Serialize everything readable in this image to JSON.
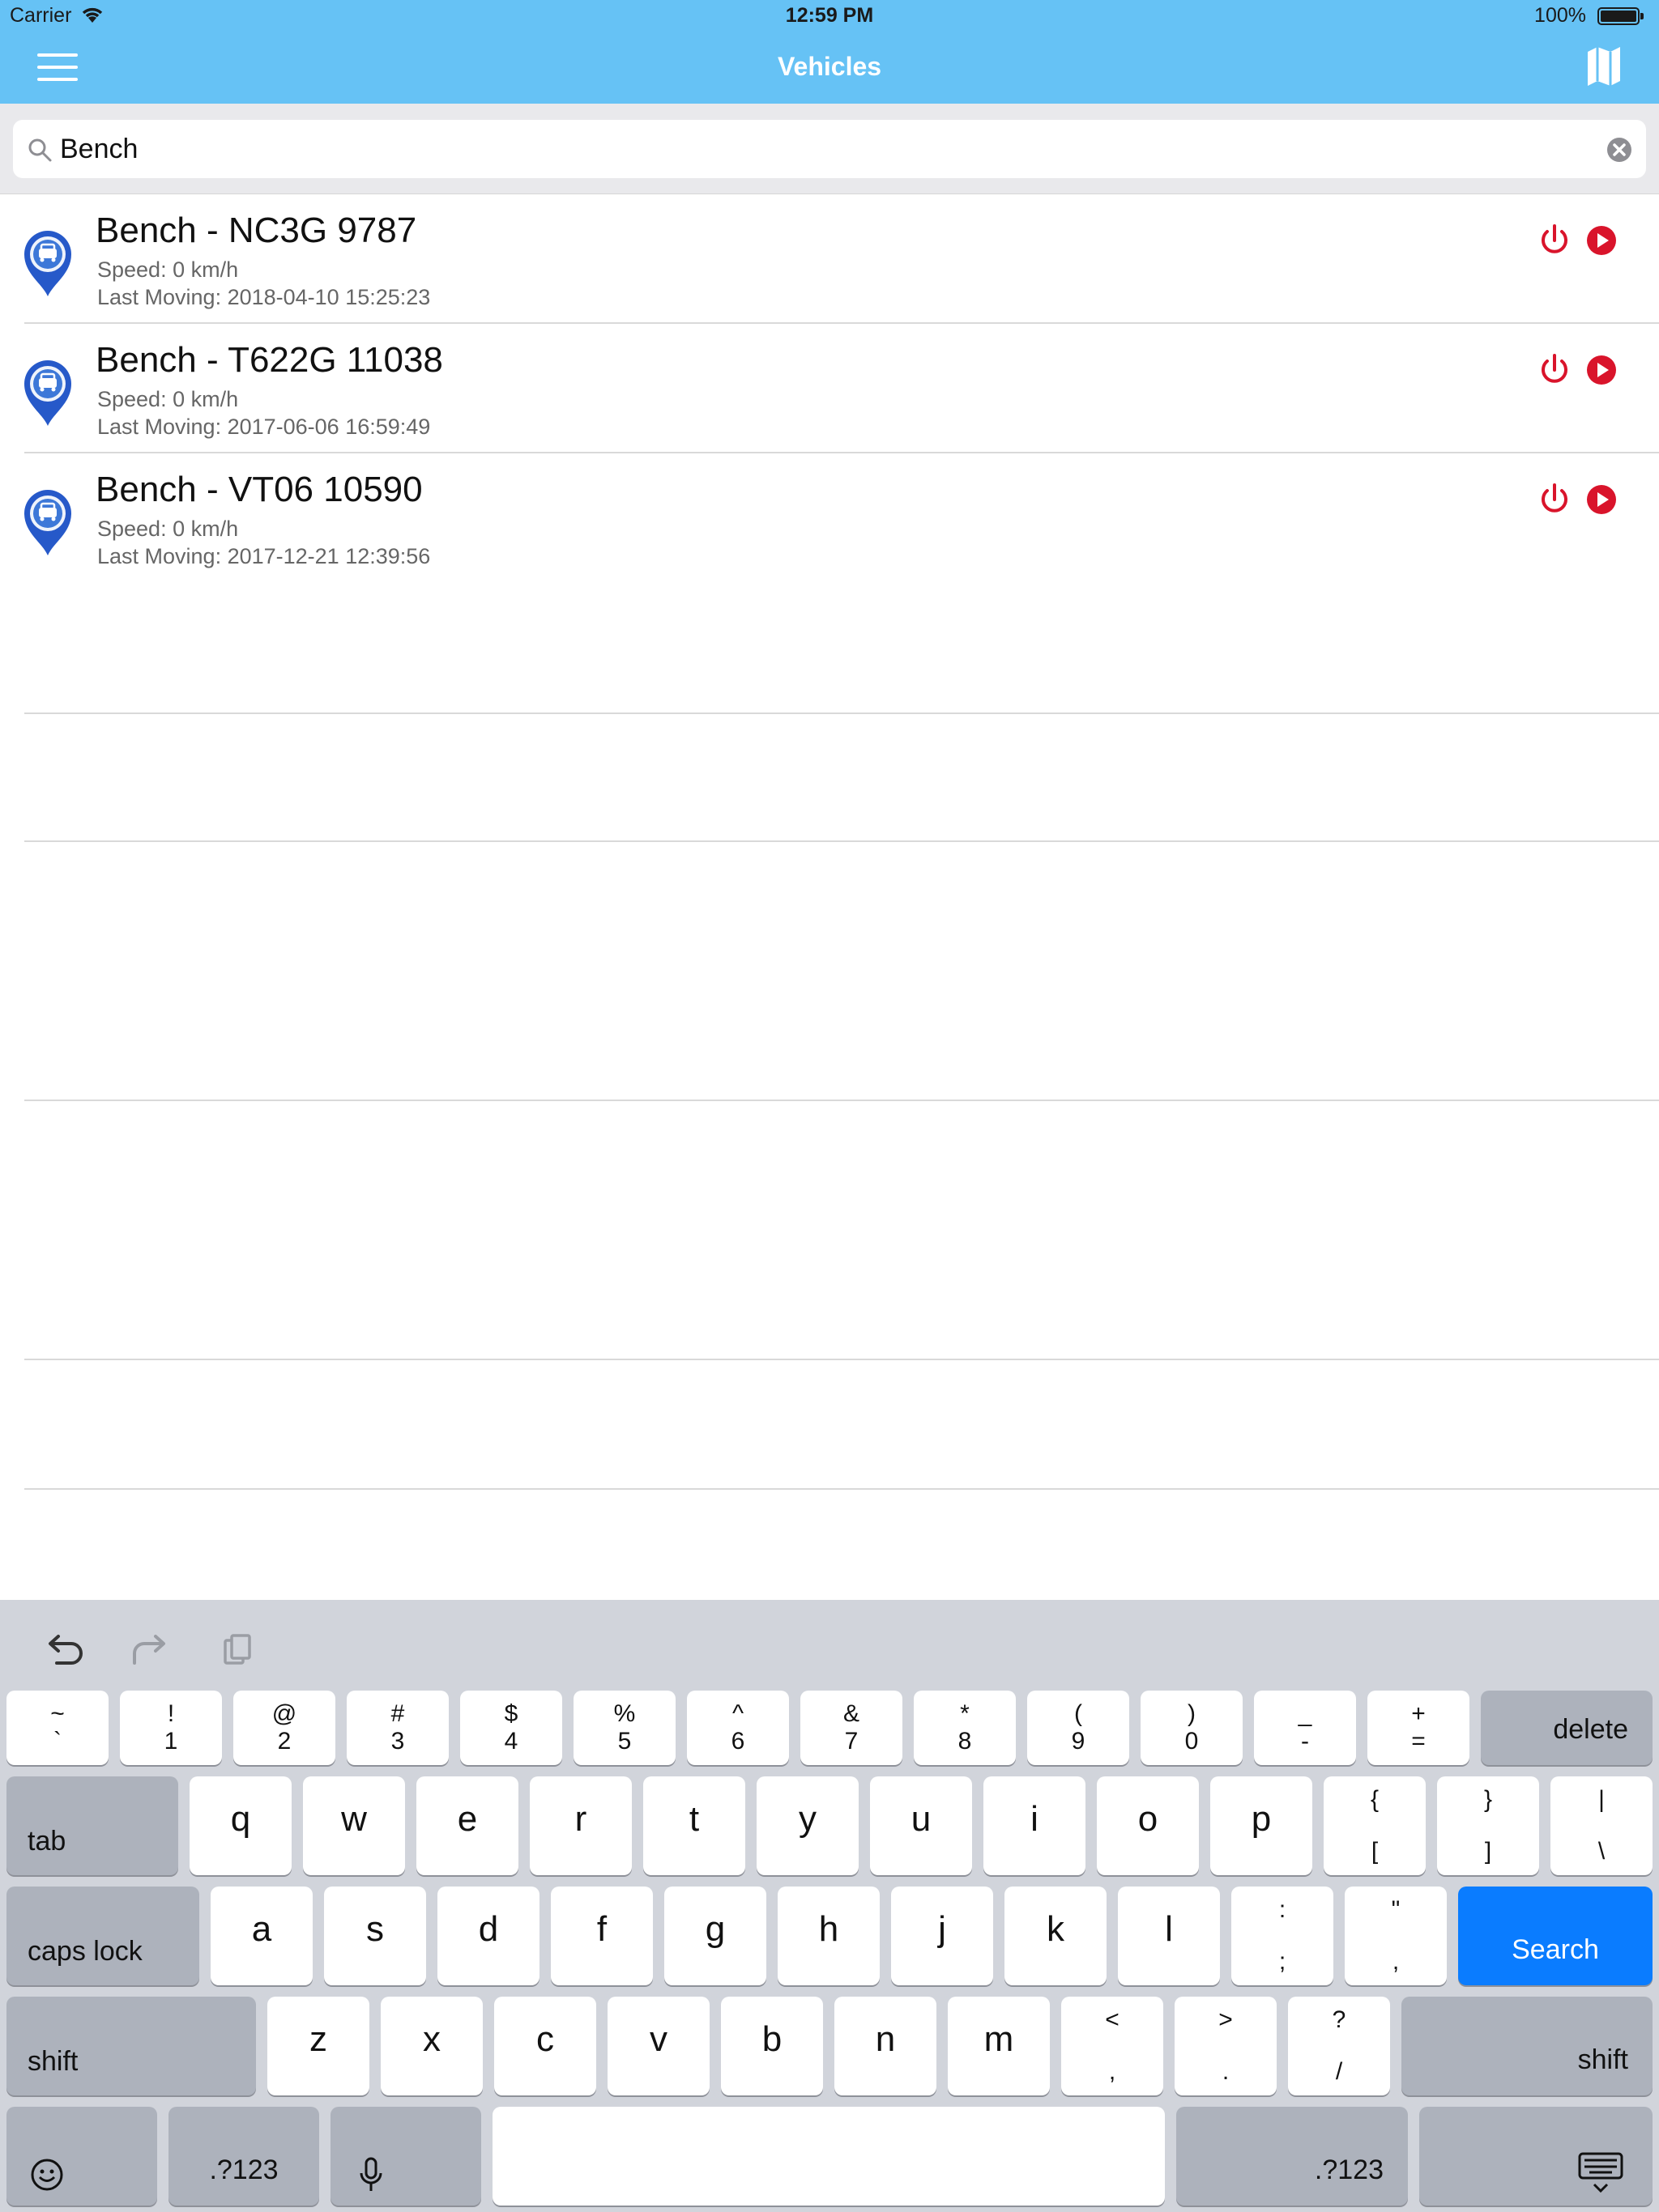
{
  "status_bar": {
    "carrier": "Carrier",
    "time": "12:59 PM",
    "battery": "100%",
    "battery_level": 1.0
  },
  "nav": {
    "title": "Vehicles",
    "menu_icon": "hamburger-menu-icon",
    "map_icon": "map-icon",
    "color": "#66c2f5"
  },
  "search": {
    "value": "Bench",
    "placeholder": ""
  },
  "vehicles": [
    {
      "name": "Bench - NC3G 9787",
      "speed": "Speed: 0 km/h",
      "last_moving": "Last Moving: 2018-04-10 15:25:23"
    },
    {
      "name": "Bench - T622G 11038",
      "speed": "Speed: 0 km/h",
      "last_moving": "Last Moving: 2017-06-06 16:59:49"
    },
    {
      "name": "Bench - VT06 10590",
      "speed": "Speed: 0 km/h",
      "last_moving": "Last Moving: 2017-12-21 12:39:56"
    }
  ],
  "keyboard": {
    "row1": [
      {
        "top": "~",
        "bot": "`"
      },
      {
        "top": "!",
        "bot": "1"
      },
      {
        "top": "@",
        "bot": "2"
      },
      {
        "top": "#",
        "bot": "3"
      },
      {
        "top": "$",
        "bot": "4"
      },
      {
        "top": "%",
        "bot": "5"
      },
      {
        "top": "^",
        "bot": "6"
      },
      {
        "top": "&",
        "bot": "7"
      },
      {
        "top": "*",
        "bot": "8"
      },
      {
        "top": "(",
        "bot": "9"
      },
      {
        "top": ")",
        "bot": "0"
      },
      {
        "top": "_",
        "bot": "-"
      },
      {
        "top": "+",
        "bot": "="
      }
    ],
    "delete": "delete",
    "tab": "tab",
    "row2": [
      "q",
      "w",
      "e",
      "r",
      "t",
      "y",
      "u",
      "i",
      "o",
      "p"
    ],
    "row2_sym": [
      {
        "top": "{",
        "bot": "["
      },
      {
        "top": "}",
        "bot": "]"
      },
      {
        "top": "|",
        "bot": "\\"
      }
    ],
    "caps": "caps lock",
    "row3": [
      "a",
      "s",
      "d",
      "f",
      "g",
      "h",
      "j",
      "k",
      "l"
    ],
    "row3_sym": [
      {
        "top": ":",
        "bot": ";"
      },
      {
        "top": "\"",
        "bot": ","
      }
    ],
    "search": "Search",
    "shift": "shift",
    "row4": [
      "z",
      "x",
      "c",
      "v",
      "b",
      "n",
      "m"
    ],
    "row4_sym": [
      {
        "top": "<",
        "bot": ","
      },
      {
        "top": ">",
        "bot": "."
      },
      {
        "top": "?",
        "bot": "/"
      }
    ],
    "num": ".?123",
    "accent": "#0a7cff"
  }
}
